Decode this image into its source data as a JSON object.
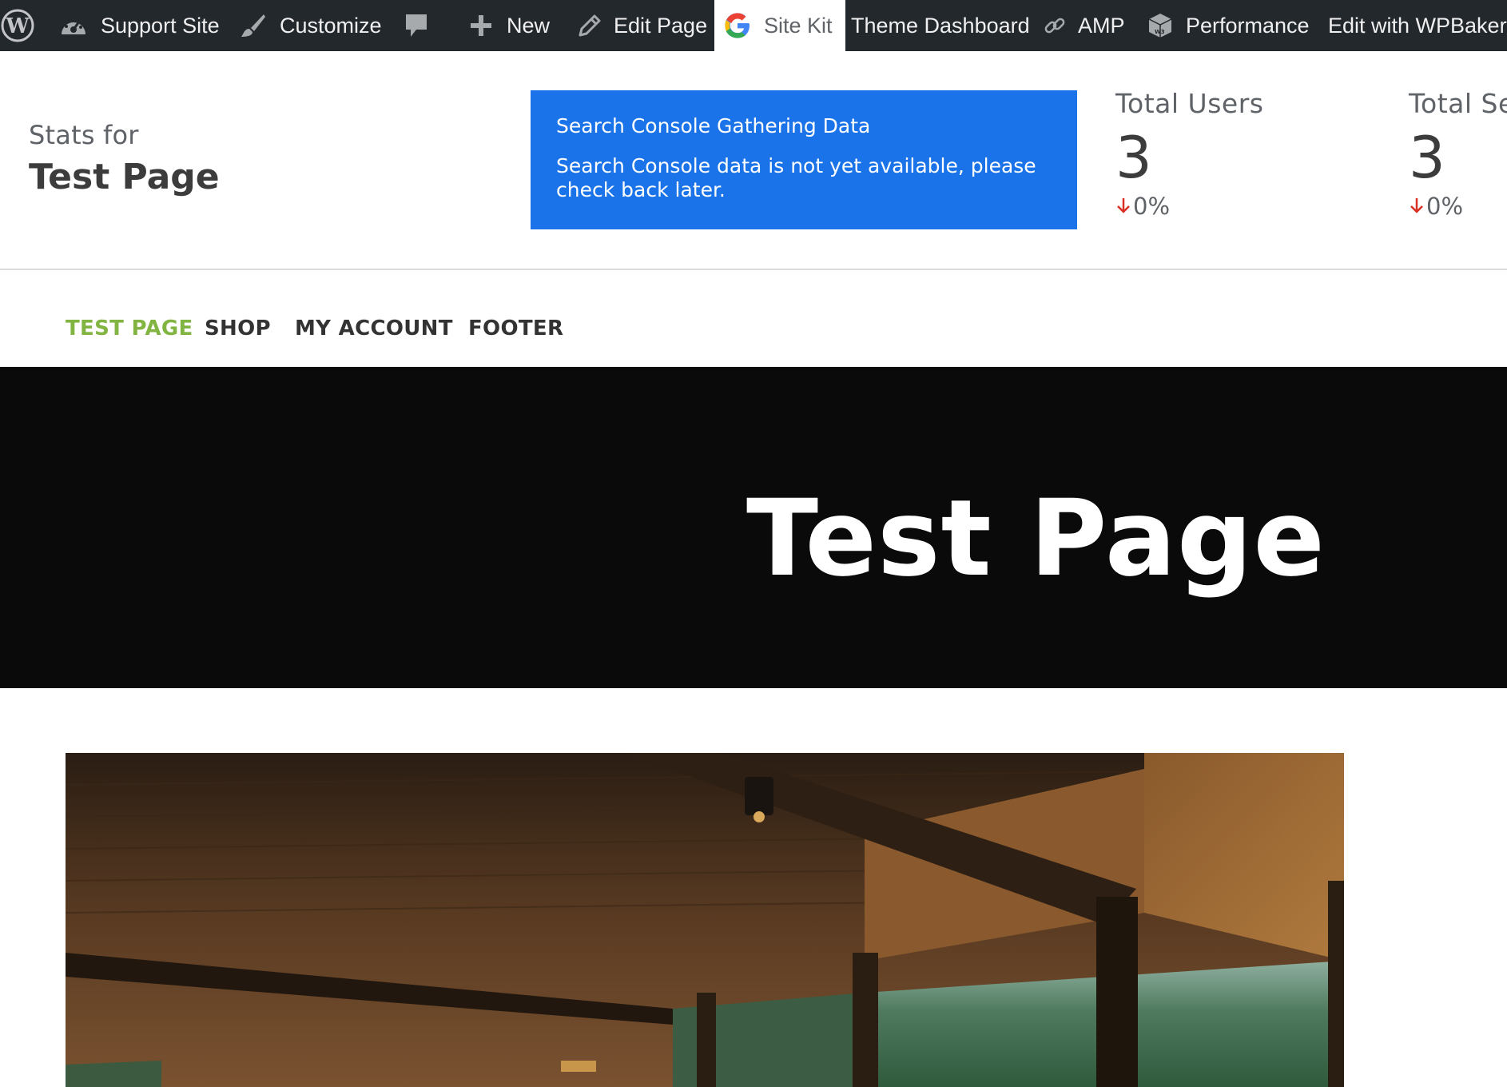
{
  "admin_bar": {
    "items": [
      {
        "label": "",
        "icon": "wordpress-logo-icon"
      },
      {
        "label": "Support Site",
        "icon": "dashboard-icon"
      },
      {
        "label": "Customize",
        "icon": "paintbrush-icon"
      },
      {
        "label": "",
        "icon": "comment-icon"
      },
      {
        "label": "New",
        "icon": "plus-icon"
      },
      {
        "label": "Edit Page",
        "icon": "pencil-icon"
      },
      {
        "label": "Site Kit",
        "icon": "google-g-icon"
      },
      {
        "label": "Theme Dashboard",
        "icon": ""
      },
      {
        "label": "AMP",
        "icon": "amp-link-icon"
      },
      {
        "label": "Performance",
        "icon": "w3tc-cube-icon"
      },
      {
        "label": "Edit with WPBakery",
        "icon": ""
      }
    ]
  },
  "site_kit": {
    "stats_for_label": "Stats for",
    "page_title": "Test Page",
    "notice": {
      "title": "Search Console Gathering Data",
      "body": "Search Console data is not yet available, please check back later."
    },
    "metrics": [
      {
        "label": "Total Users",
        "value": "3",
        "change": "0%",
        "trend": "down"
      },
      {
        "label": "Total Se",
        "value": "3",
        "change": "0%",
        "trend": "down"
      }
    ]
  },
  "site_nav": {
    "items": [
      "TEST PAGE",
      "SHOP",
      "MY ACCOUNT",
      "FOOTER"
    ],
    "active_index": 0,
    "active_color": "#81b441"
  },
  "hero": {
    "title": "Test Page"
  },
  "colors": {
    "admin_bar_bg": "#23282d",
    "notice_bg": "#1a73e8",
    "hero_bg": "#0a0a0b",
    "trend_down": "#d93025"
  }
}
